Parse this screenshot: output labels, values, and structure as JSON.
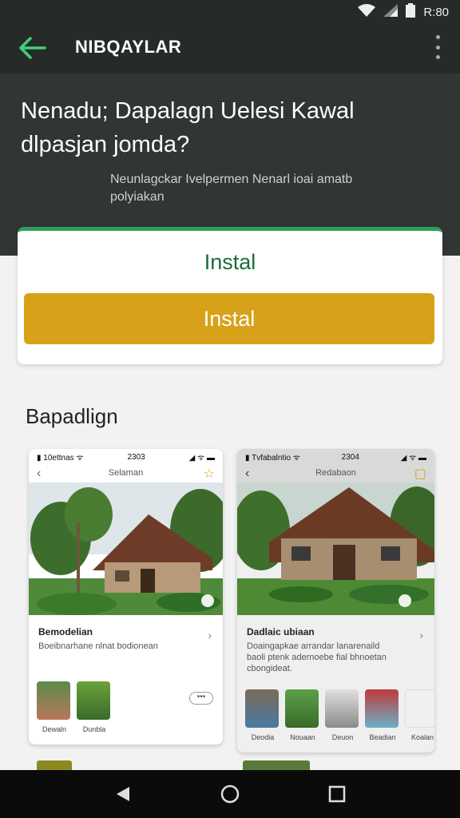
{
  "status_bar": {
    "time": "R:80"
  },
  "app_bar": {
    "title": "NIBQAYLAR"
  },
  "hero": {
    "headline": "Nenadu; Dapalagn Uelesi Kawal dlpasjan jomda?",
    "subtitle": "Neunlagckar Ivelpermen Nenarl ioai amatb polyiakan"
  },
  "install_card": {
    "label": "Instal",
    "button_label": "Instal"
  },
  "section": {
    "title": "Bapadlign"
  },
  "screenshots": [
    {
      "status_left": "▮ 10ettnas ᯤ",
      "status_center": "2303",
      "status_right": "◢ ᯤ ▬",
      "nav_title": "Selaman",
      "heading": "Bemodelian",
      "description": "Boeibnarhane nlnat bodionean",
      "thumbs": [
        {
          "caption": "Dewaln"
        },
        {
          "caption": "Dunbla"
        }
      ],
      "more_label": "•••"
    },
    {
      "status_left": "▮ Tvfabalntio ᯤ",
      "status_center": "2304",
      "status_right": "◢ ᯤ ▬",
      "nav_title": "Redabaon",
      "heading": "Dadlaic ubiaan",
      "description": "Doaingapkae arrandar lanarenaild baoli ptenk adernoebe fial bhnoetan cbongideat.",
      "thumbs": [
        {
          "caption": "Deodia"
        },
        {
          "caption": "Nouaan"
        },
        {
          "caption": "Deuon"
        },
        {
          "caption": "Beadian"
        },
        {
          "caption": "Koalan"
        }
      ]
    }
  ],
  "colors": {
    "accent_green": "#2f9e5a",
    "install_gold": "#d8a11a",
    "header_dark": "#262a29"
  }
}
